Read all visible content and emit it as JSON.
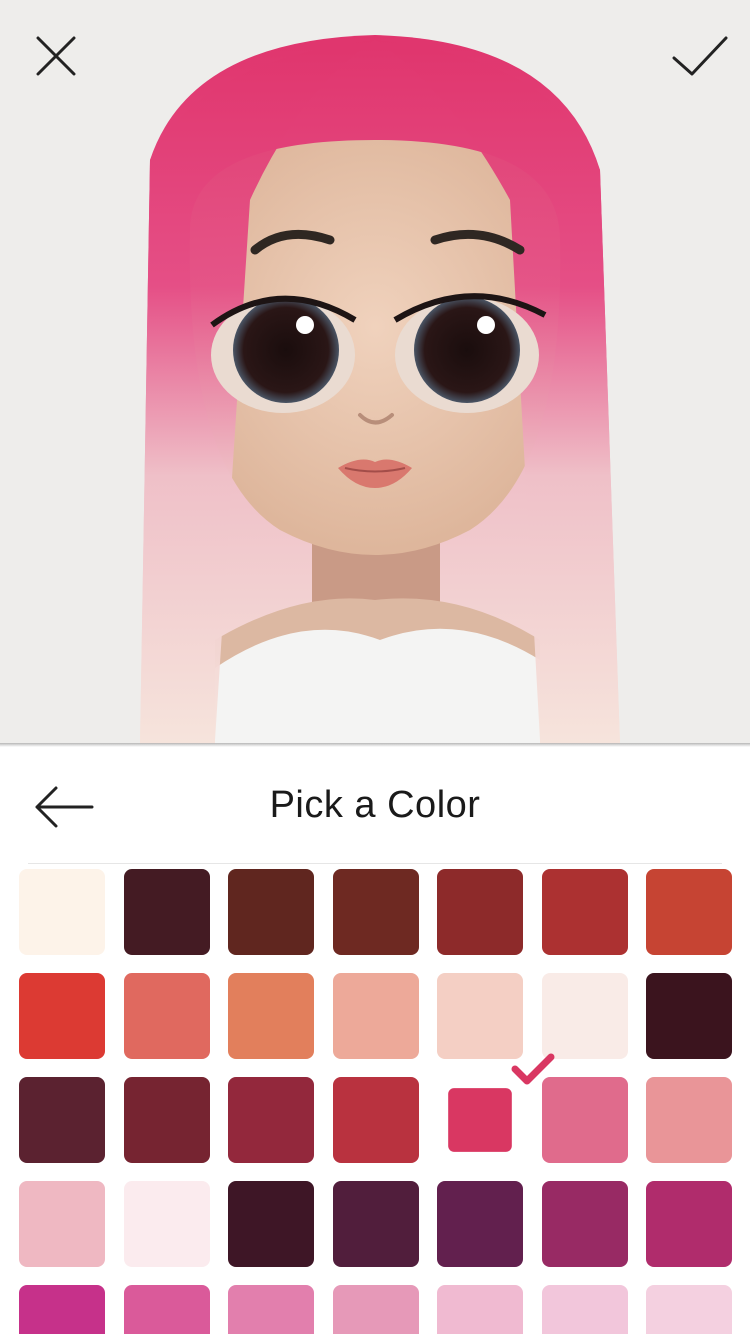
{
  "toolbar": {
    "close_icon": "close-icon",
    "confirm_icon": "checkmark-icon"
  },
  "picker": {
    "title": "Pick a Color",
    "back_icon": "arrow-left-icon",
    "selected_index": 18,
    "swatches": [
      "#fdf3e9",
      "#441b23",
      "#60261f",
      "#6e2922",
      "#8d2a2a",
      "#ac3131",
      "#c64433",
      "#dc3a33",
      "#e0695f",
      "#e27f5c",
      "#eda999",
      "#f4cfc4",
      "#f9ebe7",
      "#3b141e",
      "#5b2230",
      "#762431",
      "#93283c",
      "#b9323f",
      "#d93762",
      "#e06b8c",
      "#e99598",
      "#efb8c2",
      "#fbebee",
      "#3e1626",
      "#511e3c",
      "#62204e",
      "#982a64",
      "#b02c6c",
      "#c6318a",
      "#da5a9a",
      "#e27fad",
      "#e699b8",
      "#f0bad1",
      "#f2c6db",
      "#f4d0e0"
    ]
  }
}
